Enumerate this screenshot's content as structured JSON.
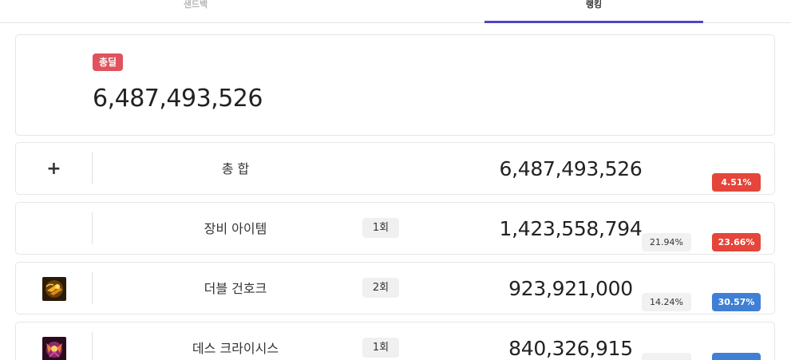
{
  "tabs": [
    {
      "label": "샌드백"
    },
    {
      "label": "랭킹"
    }
  ],
  "summary": {
    "badge": "총딜",
    "total": "6,487,493,526"
  },
  "rows": [
    {
      "label": "총 합",
      "count": "",
      "damage": "6,487,493,526",
      "share": "",
      "change": "4.51%",
      "change_color": "#e5453a",
      "icon": "plus-icon"
    },
    {
      "label": "장비 아이템",
      "count": "1회",
      "damage": "1,423,558,794",
      "share": "21.94%",
      "change": "23.66%",
      "change_color": "#e5453a",
      "icon": ""
    },
    {
      "label": "더블 건호크",
      "count": "2회",
      "damage": "923,921,000",
      "share": "14.24%",
      "change": "30.57%",
      "change_color": "#3f7fd6",
      "icon": "double-gunhawk-skill-icon"
    },
    {
      "label": "데스 크라이시스",
      "count": "1회",
      "damage": "840,326,915",
      "share": "",
      "change": "",
      "change_color": "#3f7fd6",
      "icon": "death-crisis-skill-icon"
    }
  ]
}
